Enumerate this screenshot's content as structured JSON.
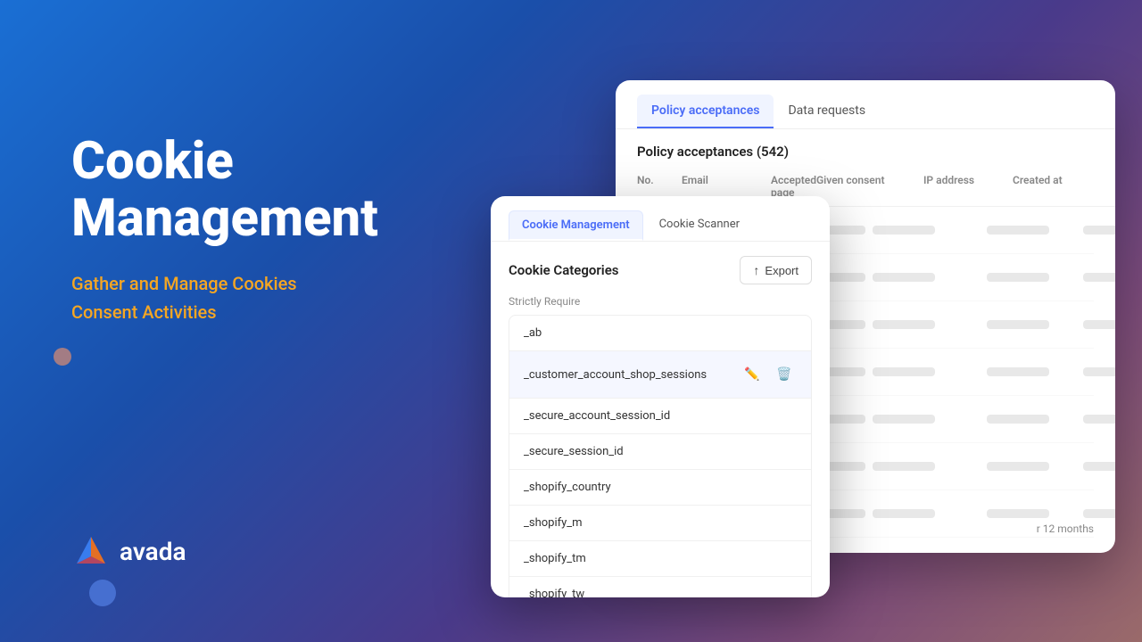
{
  "background": {
    "gradient_start": "#1a6fd4",
    "gradient_end": "#9a6a6a"
  },
  "left": {
    "title_line1": "Cookie",
    "title_line2": "Management",
    "subtitle_line1": "Gather and Manage Cookies",
    "subtitle_line2": "Consent Activities"
  },
  "logo": {
    "text": "avada"
  },
  "policy_panel": {
    "tab_active": "Policy acceptances",
    "tab_inactive": "Data requests",
    "heading": "Policy acceptances (542)",
    "columns": [
      "No.",
      "Email",
      "Accepted page",
      "Given consent",
      "IP address",
      "Created at"
    ],
    "note": "r 12 months"
  },
  "cookie_panel": {
    "tab_active": "Cookie Management",
    "tab_inactive": "Cookie Scanner",
    "categories_title": "Cookie Categories",
    "export_label": "Export",
    "section_label": "Strictly Require",
    "items": [
      {
        "name": "_ab",
        "highlighted": false
      },
      {
        "name": "_customer_account_shop_sessions",
        "highlighted": true
      },
      {
        "name": "_secure_account_session_id",
        "highlighted": false
      },
      {
        "name": "_secure_session_id",
        "highlighted": false
      },
      {
        "name": "_shopify_country",
        "highlighted": false
      },
      {
        "name": "_shopify_m",
        "highlighted": false
      },
      {
        "name": "_shopify_tm",
        "highlighted": false
      },
      {
        "name": "_shopify_tw",
        "highlighted": false
      }
    ]
  }
}
